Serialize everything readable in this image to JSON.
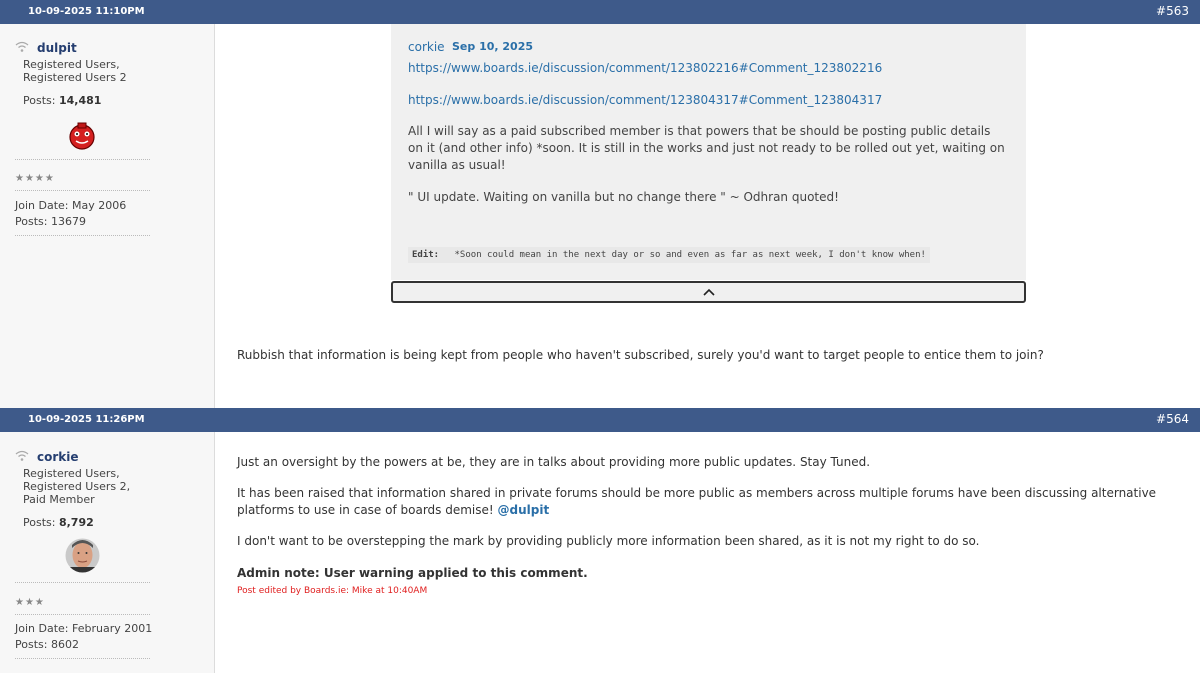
{
  "posts": [
    {
      "date": "10-09-2025 11:10PM",
      "number": "#563",
      "user": {
        "name": "dulpit",
        "group1": "Registered Users,",
        "group2": "Registered Users 2",
        "posts_label": "Posts:",
        "posts_count": "14,481",
        "stars": "★★★★",
        "join_date": "Join Date: May 2006",
        "posts_total": "Posts: 13679"
      },
      "quote": {
        "author": "corkie",
        "date": "Sep 10, 2025",
        "link1": "https://www.boards.ie/discussion/comment/123802216#Comment_123802216",
        "link2": "https://www.boards.ie/discussion/comment/123804317#Comment_123804317",
        "para1": "All I will say as a paid subscribed member is that powers that be should be posting public details on it (and other info) *soon. It is still in the works and just not ready to be rolled out yet, waiting on vanilla as usual!",
        "para2": "\" UI update. Waiting on vanilla but no change there \" ~ Odhran quoted!",
        "edit_label": "Edit:",
        "edit_text": "*Soon could mean in the next day or so and even as far as next week, I don't know when!"
      },
      "body": "Rubbish that information is being kept from people who haven't subscribed, surely you'd want to target people to entice them to join?"
    },
    {
      "date": "10-09-2025 11:26PM",
      "number": "#564",
      "user": {
        "name": "corkie",
        "group1": "Registered Users,",
        "group2": "Registered Users 2,",
        "group3": "Paid Member",
        "posts_label": "Posts:",
        "posts_count": "8,792",
        "stars": "★★★",
        "join_date": "Join Date: February 2001",
        "posts_total": "Posts: 8602"
      },
      "para1": "Just an oversight by the powers at be, they are in talks about providing more public updates. Stay Tuned.",
      "para2": "It has been raised that information shared in private forums should be more public as members across multiple forums have been discussing alternative platforms to use in case of boards demise!",
      "mention": "@dulpit",
      "para3": "I don't want to be overstepping the mark by providing publicly more information been shared, as it is not my right to do so.",
      "admin_note": "Admin note: User warning applied to this comment.",
      "edited": "Post edited by Boards.ie: Mike at 10:40AM"
    }
  ]
}
